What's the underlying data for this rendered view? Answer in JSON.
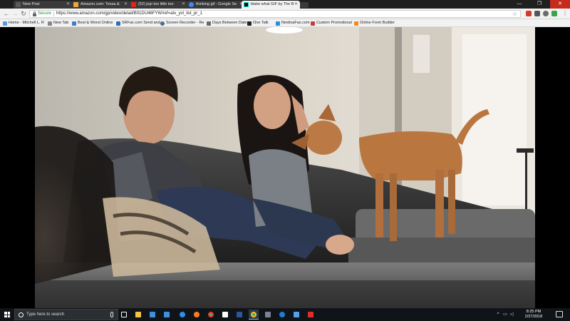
{
  "tabs": [
    {
      "label": "New Post",
      "icon": "page-icon",
      "color": "#5a5a5a",
      "active": false
    },
    {
      "label": "Amazon.com: Tessa &",
      "icon": "amazon-icon",
      "color": "#f0a43a",
      "active": false
    },
    {
      "label": "(52) jojo too little too",
      "icon": "youtube-icon",
      "color": "#e62117",
      "active": false
    },
    {
      "label": "thinking gif - Google Se",
      "icon": "google-icon",
      "color": "#4285f4",
      "active": false
    },
    {
      "label": "blake what GIF by The B",
      "icon": "giphy-icon",
      "color": "#00e6cc",
      "active": true
    }
  ],
  "toolbar": {
    "back": "←",
    "forward": "→",
    "reload": "↻",
    "secure_label": "Secure",
    "url": "https://www.amazon.com/gp/video/detail/B01DU46FYW/ref=atv_yvl_list_pr_1",
    "star": "☆"
  },
  "bookmarks": [
    {
      "label": "Home - Mitchell L. R",
      "color": "#5a9bd4"
    },
    {
      "label": "New Tab",
      "color": "#888"
    },
    {
      "label": "Best & Worst Online",
      "color": "#3f7fc6"
    },
    {
      "label": "SRFax.com Send and",
      "color": "#2f6fb6"
    },
    {
      "label": "Screen Recorder - Re",
      "color": "#4a6c8e"
    },
    {
      "label": "Days Between Dates",
      "color": "#6a6a6a"
    },
    {
      "label": "One Talk",
      "color": "#222"
    },
    {
      "label": "NextivaFax.com",
      "color": "#2b8fd6"
    },
    {
      "label": "Custom Promotional",
      "color": "#c04040"
    },
    {
      "label": "Online Form Builder",
      "color": "#f08a24"
    }
  ],
  "window": {
    "minimize": "—",
    "maximize": "❐",
    "close": "✕"
  },
  "taskbar": {
    "search_placeholder": "Type here to search",
    "time": "8:25 PM",
    "date": "2/27/2018",
    "apps": [
      {
        "name": "task-view",
        "color": "#ffffff"
      },
      {
        "name": "file-explorer",
        "color": "#f3c545"
      },
      {
        "name": "store",
        "color": "#3d8fe0"
      },
      {
        "name": "mail",
        "color": "#3d8fe0"
      },
      {
        "name": "edge",
        "color": "#2f8ee6"
      },
      {
        "name": "firefox",
        "color": "#ff7a25"
      },
      {
        "name": "chrome",
        "color": "#4caf50"
      },
      {
        "name": "messages",
        "color": "#ffffff"
      },
      {
        "name": "word",
        "color": "#2b5797"
      },
      {
        "name": "chrome-active",
        "color": "#4caf50"
      },
      {
        "name": "app-dark",
        "color": "#7a8592"
      },
      {
        "name": "hp",
        "color": "#1f7dd4"
      },
      {
        "name": "app-blue",
        "color": "#53a2e8"
      },
      {
        "name": "acrobat",
        "color": "#e52b2b"
      }
    ]
  }
}
